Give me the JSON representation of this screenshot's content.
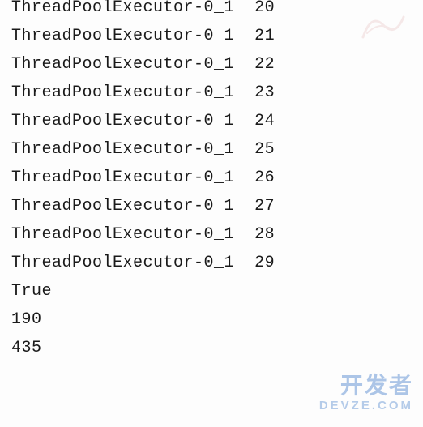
{
  "console": {
    "rows": [
      {
        "thread": "ThreadPoolExecutor-0_1",
        "value": "20"
      },
      {
        "thread": "ThreadPoolExecutor-0_1",
        "value": "21"
      },
      {
        "thread": "ThreadPoolExecutor-0_1",
        "value": "22"
      },
      {
        "thread": "ThreadPoolExecutor-0_1",
        "value": "23"
      },
      {
        "thread": "ThreadPoolExecutor-0_1",
        "value": "24"
      },
      {
        "thread": "ThreadPoolExecutor-0_1",
        "value": "25"
      },
      {
        "thread": "ThreadPoolExecutor-0_1",
        "value": "26"
      },
      {
        "thread": "ThreadPoolExecutor-0_1",
        "value": "27"
      },
      {
        "thread": "ThreadPoolExecutor-0_1",
        "value": "28"
      },
      {
        "thread": "ThreadPoolExecutor-0_1",
        "value": "29"
      }
    ],
    "tail": [
      "True",
      "190",
      "435"
    ]
  },
  "watermark": {
    "line1": "开发者",
    "line2": "DEVZE.COM"
  }
}
